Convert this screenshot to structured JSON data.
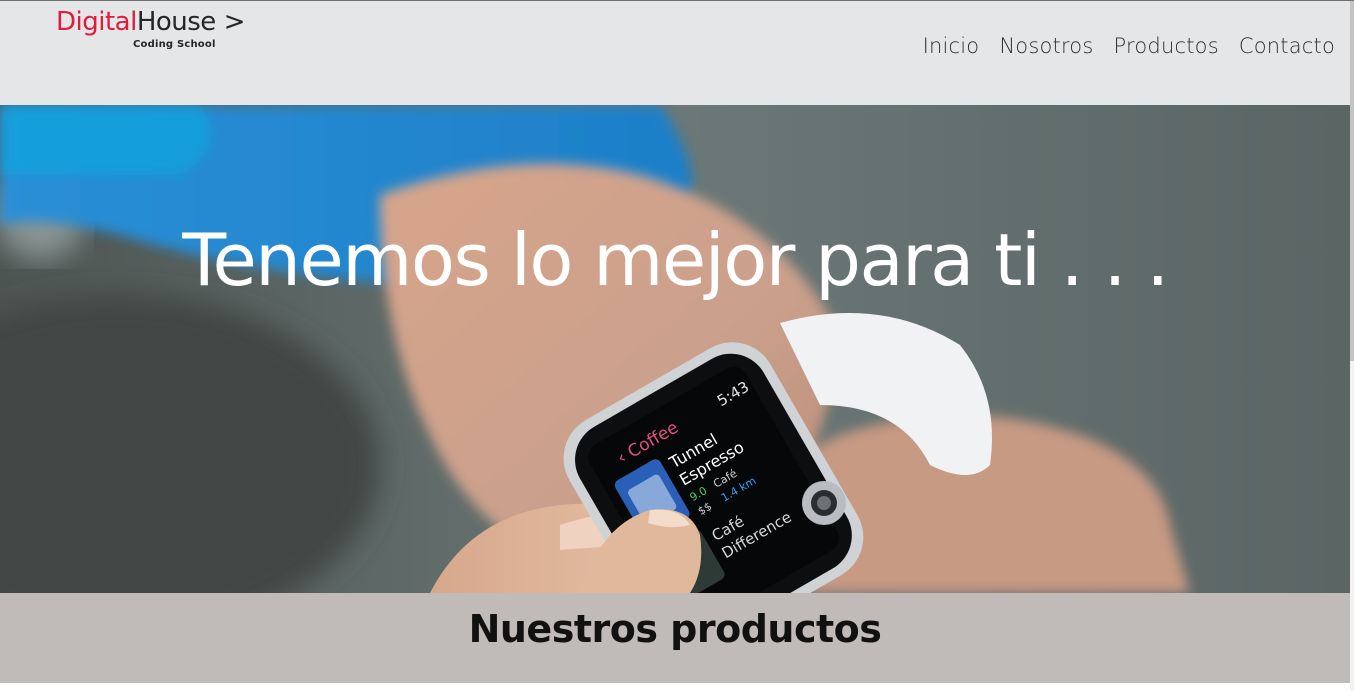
{
  "logo": {
    "brand_red": "Digital",
    "brand_dark": "House",
    "arrow": ">",
    "subtitle": "Coding School"
  },
  "nav": {
    "items": [
      {
        "label": "Inicio"
      },
      {
        "label": "Nosotros"
      },
      {
        "label": "Productos"
      },
      {
        "label": "Contacto"
      }
    ]
  },
  "hero": {
    "title": "Tenemos lo mejor para ti . . .",
    "watch_screen": {
      "header": "Coffee",
      "time": "5:43",
      "line1": "Tunnel",
      "line2": "Espresso",
      "rating": "9.0",
      "category": "Café",
      "price": "$$",
      "distance": "1.4 km",
      "line3": "Café",
      "line4": "Difference"
    }
  },
  "products": {
    "title": "Nuestros productos"
  },
  "colors": {
    "header_bg": "#e5e6e8",
    "brand_red": "#e01c3c",
    "band_bg": "#c0bbb8"
  }
}
